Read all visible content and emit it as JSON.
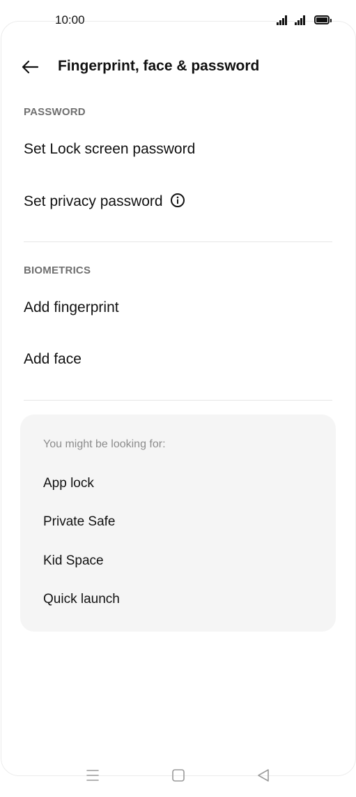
{
  "status_bar": {
    "time": "10:00"
  },
  "header": {
    "title": "Fingerprint, face & password"
  },
  "sections": {
    "password": {
      "label": "PASSWORD",
      "items": [
        {
          "label": "Set Lock screen password"
        },
        {
          "label": "Set privacy password"
        }
      ]
    },
    "biometrics": {
      "label": "BIOMETRICS",
      "items": [
        {
          "label": "Add fingerprint"
        },
        {
          "label": "Add face"
        }
      ]
    }
  },
  "suggestions": {
    "title": "You might be looking for:",
    "items": [
      {
        "label": "App lock"
      },
      {
        "label": "Private Safe"
      },
      {
        "label": "Kid Space"
      },
      {
        "label": "Quick launch"
      }
    ]
  },
  "icons": {
    "back": "arrow-left-icon",
    "info": "info-circle-icon",
    "signal": "signal-icon",
    "battery": "battery-icon",
    "nav_recents": "menu-icon",
    "nav_home": "square-icon",
    "nav_back": "triangle-back-icon"
  },
  "colors": {
    "text_primary": "#111111",
    "section_header": "#6f6f6f",
    "card_background": "#f5f5f5",
    "divider": "#e6e6e6"
  }
}
